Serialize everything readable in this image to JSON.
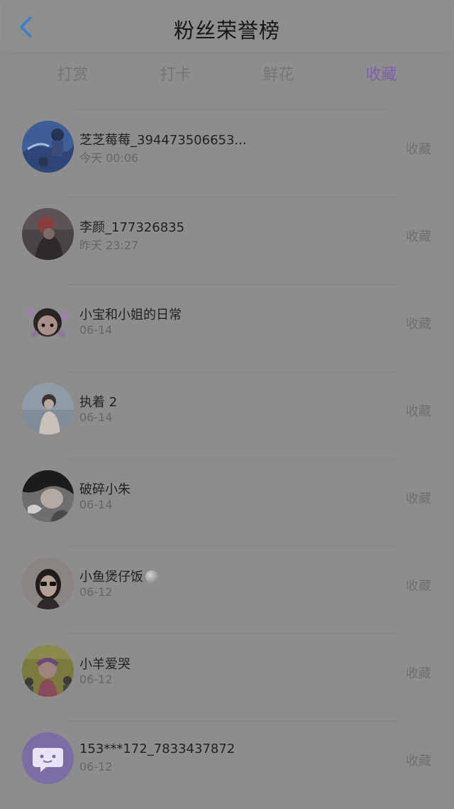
{
  "header": {
    "title": "粉丝荣誉榜",
    "back_icon": "chevron-left-icon",
    "back_color": "#2f80d1"
  },
  "tabs": [
    {
      "label": "打赏"
    },
    {
      "label": "打卡"
    },
    {
      "label": "鲜花"
    },
    {
      "label": "收藏",
      "active": true
    }
  ],
  "active_color": "#7b63a8",
  "rows": [
    {
      "name": "芝芝莓莓_394473506653...",
      "time": "今天 00:06",
      "action": "收藏"
    },
    {
      "name": "李颜_177326835",
      "time": "昨天 23:27",
      "action": "收藏"
    },
    {
      "name": "小宝和小姐的日常",
      "time": "06-14",
      "action": "收藏"
    },
    {
      "name": "执着 2",
      "time": "06-14",
      "action": "收藏"
    },
    {
      "name": "破碎小朱",
      "time": "06-14",
      "action": "收藏"
    },
    {
      "name": "小鱼煲仔饭",
      "time": "06-12",
      "action": "收藏",
      "emoji": "moon-icon"
    },
    {
      "name": "小羊爱哭",
      "time": "06-12",
      "action": "收藏"
    },
    {
      "name": "153***172_7833437872",
      "time": "06-12",
      "action": "收藏"
    }
  ]
}
